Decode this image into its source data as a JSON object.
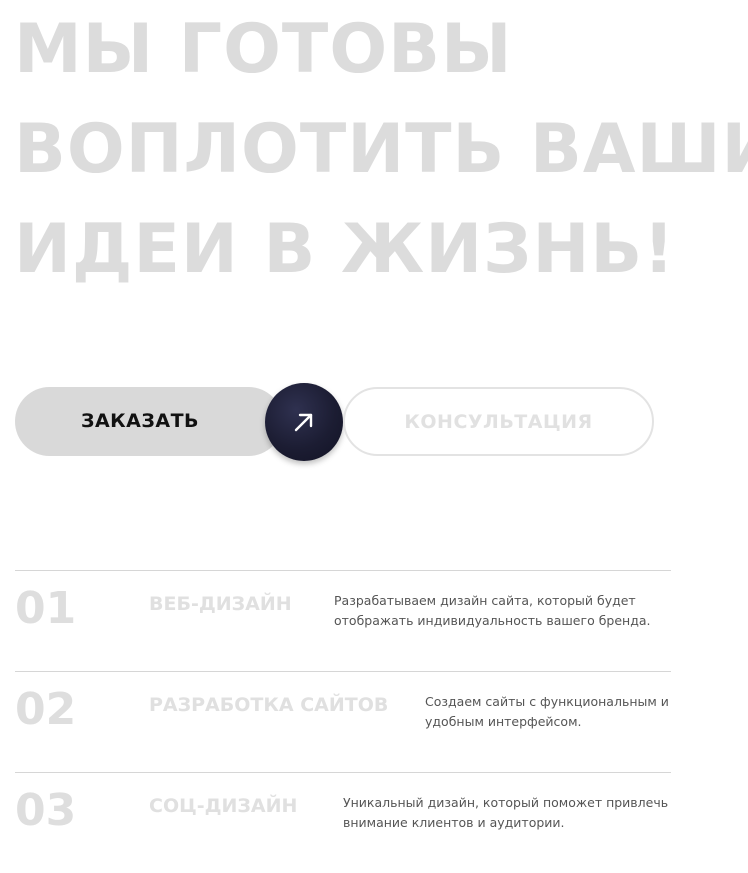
{
  "hero": {
    "lines": [
      "МЫ ГОТОВЫ",
      "ВОПЛОТИТЬ ВАШИ",
      "ИДЕИ В ЖИЗНЬ!"
    ]
  },
  "actions": {
    "order_label": "ЗАКАЗАТЬ",
    "arrow_icon": "arrow-up-right-icon",
    "consult_label": "КОНСУЛЬТАЦИЯ"
  },
  "services": [
    {
      "number": "01",
      "title": "ВЕБ-ДИЗАЙН",
      "description": "Разрабатываем дизайн сайта, который будет отображать индивидуальность вашего бренда."
    },
    {
      "number": "02",
      "title": "РАЗРАБОТКА САЙТОВ",
      "description": "Создаем сайты с функциональным и удобным интерфейсом."
    },
    {
      "number": "03",
      "title": "СОЦ-ДИЗАЙН",
      "description": "Уникальный дизайн, который поможет привлечь внимание клиентов и аудитории."
    }
  ],
  "colors": {
    "hero_text": "#dcdcdc",
    "order_button_bg": "#d9d9d9",
    "arrow_button_bg": "#1c1d33",
    "divider": "#d6d6d6",
    "muted_text": "#e0e0e0",
    "body_text": "#555555"
  }
}
